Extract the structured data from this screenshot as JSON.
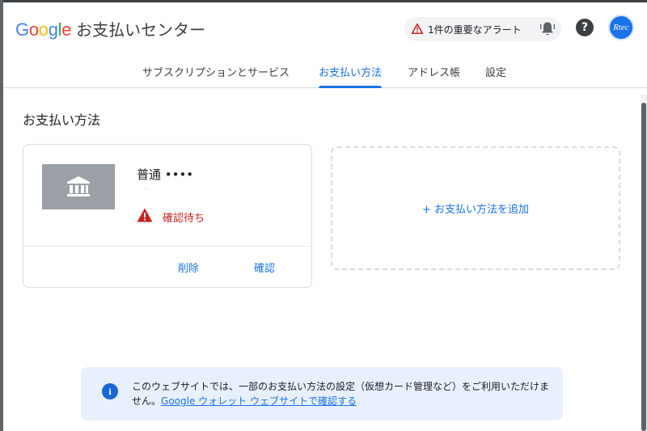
{
  "header": {
    "logo_letters": [
      "G",
      "o",
      "o",
      "g",
      "l",
      "e"
    ],
    "title": "お支払いセンター",
    "alert_text": "1件の重要なアラート",
    "help_label": "?",
    "avatar_text": "Rtec"
  },
  "tabs": [
    {
      "label": "サブスクリプションとサービス",
      "active": false
    },
    {
      "label": "お支払い方法",
      "active": true
    },
    {
      "label": "アドレス帳",
      "active": false
    },
    {
      "label": "設定",
      "active": false
    }
  ],
  "main": {
    "section_title": "お支払い方法",
    "payment_card": {
      "name": "普通 ••••",
      "sub": "-",
      "status": "確認待ち",
      "delete_label": "削除",
      "verify_label": "確認"
    },
    "add_label": "+ お支払い方法を追加"
  },
  "info": {
    "text": "このウェブサイトでは、一部のお支払い方法の設定（仮想カード管理など）をご利用いただけません。",
    "link": "Google ウォレット ウェブサイトで確認する",
    "icon": "i"
  },
  "colors": {
    "accent": "#1a73e8",
    "warning": "#c5221f",
    "info_bg": "#e8f0fe"
  }
}
